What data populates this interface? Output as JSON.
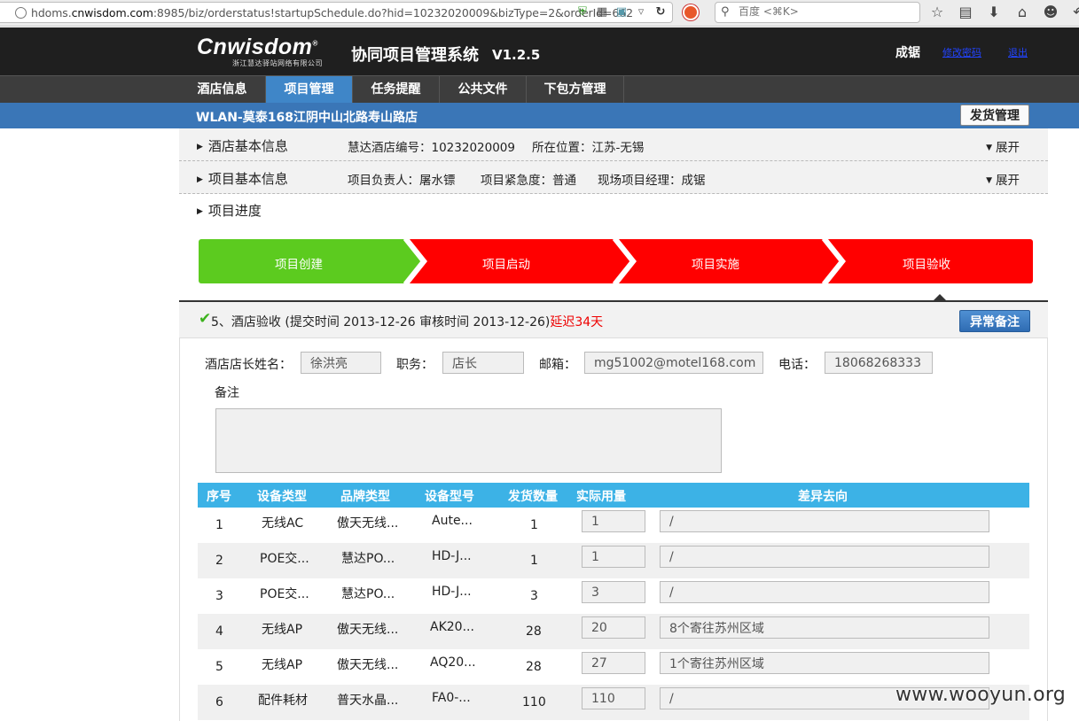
{
  "browser": {
    "url_prefix": "hdoms.",
    "url_domain": "cnwisdom.com",
    "url_suffix": ":8985/biz/orderstatus!startupSchedule.do?hid=10232020009&bizType=2&orderId=662",
    "search_placeholder": "百度 <⌘K>"
  },
  "header": {
    "logo": "Cnwisdom",
    "logo_mark": "®",
    "logo_sub": "浙江慧达驿站网络有限公司",
    "system_title": "协同项目管理系统",
    "version": "V1.2.5",
    "user": "成锯",
    "link_change_pwd": "修改密码",
    "link_logout": "退出"
  },
  "nav": {
    "items": [
      "酒店信息",
      "项目管理",
      "任务提醒",
      "公共文件",
      "下包方管理"
    ],
    "active": "项目管理"
  },
  "hotel_bar": {
    "name": "WLAN-莫泰168江阴中山北路寿山路店",
    "ship_button": "发货管理"
  },
  "hotel_info": {
    "title": "酒店基本信息",
    "code_label": "慧达酒店编号：",
    "code": "10232020009",
    "location_label": "所在位置：",
    "location": "江苏-无锡",
    "expand": "展开"
  },
  "project_info": {
    "title": "项目基本信息",
    "owner_label": "项目负责人：",
    "owner": "屠水镖",
    "urgency_label": "项目紧急度：",
    "urgency": "普通",
    "manager_label": "现场项目经理：",
    "manager": "成锯",
    "expand": "展开"
  },
  "progress": {
    "title": "项目进度",
    "steps": [
      {
        "label": "项目创建",
        "status": "done",
        "color": "#5ccb1f"
      },
      {
        "label": "项目启动",
        "status": "pending",
        "color": "#ff0000"
      },
      {
        "label": "项目实施",
        "status": "pending",
        "color": "#ff0000"
      },
      {
        "label": "项目验收",
        "status": "pending",
        "color": "#ff0000"
      }
    ]
  },
  "acceptance": {
    "heading": "5、酒店验收 (提交时间 2013-12-26  审核时间 2013-12-26)",
    "delay": "延迟34天",
    "abnormal_button": "异常备注",
    "manager_name_label": "酒店店长姓名：",
    "manager_name": "徐洪亮",
    "position_label": "职务：",
    "position": "店长",
    "email_label": "邮箱：",
    "email": "mg51002@motel168.com",
    "phone_label": "电话：",
    "phone": "18068268333",
    "remark_label": "备注",
    "remark": ""
  },
  "table": {
    "headers": [
      "序号",
      "设备类型",
      "品牌类型",
      "设备型号",
      "发货数量",
      "实际用量",
      "差异去向"
    ],
    "rows": [
      {
        "no": "1",
        "type": "无线AC",
        "brand": "傲天无线...",
        "model": "Aute...",
        "qty": "1",
        "actual": "1",
        "diff": "/"
      },
      {
        "no": "2",
        "type": "POE交...",
        "brand": "慧达PO...",
        "model": "HD-J...",
        "qty": "1",
        "actual": "1",
        "diff": "/"
      },
      {
        "no": "3",
        "type": "POE交...",
        "brand": "慧达PO...",
        "model": "HD-J...",
        "qty": "3",
        "actual": "3",
        "diff": "/"
      },
      {
        "no": "4",
        "type": "无线AP",
        "brand": "傲天无线...",
        "model": "AK20...",
        "qty": "28",
        "actual": "20",
        "diff": "8个寄往苏州区域"
      },
      {
        "no": "5",
        "type": "无线AP",
        "brand": "傲天无线...",
        "model": "AQ20...",
        "qty": "28",
        "actual": "27",
        "diff": "1个寄往苏州区域"
      },
      {
        "no": "6",
        "type": "配件耗材",
        "brand": "普天水晶...",
        "model": "FA0-...",
        "qty": "110",
        "actual": "110",
        "diff": "/"
      }
    ]
  },
  "watermark": "www.wooyun.org"
}
